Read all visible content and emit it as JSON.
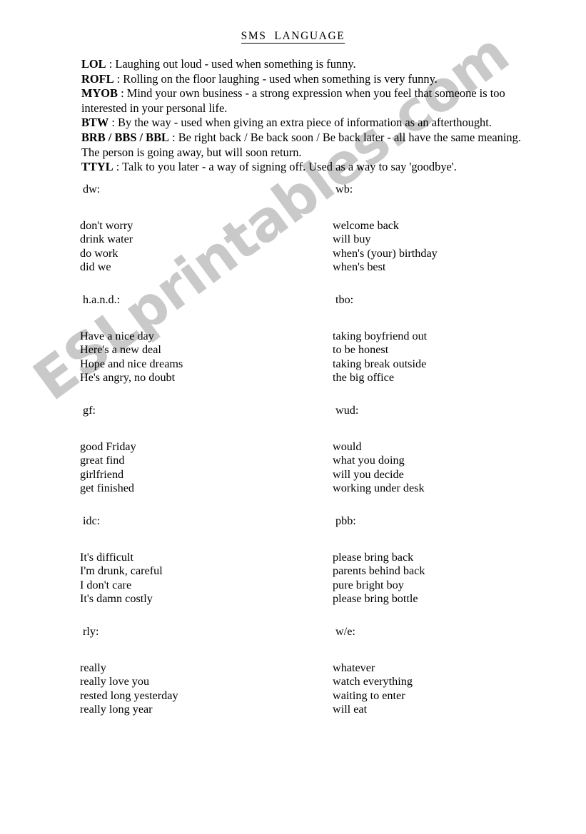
{
  "document": {
    "title": "SMS  LANGUAGE",
    "watermark": "ESLprintables.com",
    "watermark_color": "#c9c9c9"
  },
  "intro": {
    "entries": [
      {
        "abbr": "LOL",
        "sep": " : ",
        "definition": "Laughing out loud - used when something is funny."
      },
      {
        "abbr": "ROFL",
        "sep": " : ",
        "definition": "Rolling on the floor laughing - used when something is very funny."
      },
      {
        "abbr": "MYOB",
        "sep": " : ",
        "definition": "Mind your own business - a strong expression when you feel that someone is too interested in your personal life."
      },
      {
        "abbr": "BTW",
        "sep": " : ",
        "definition": "By the way - used when giving an extra piece of information as an afterthought."
      },
      {
        "abbr": "BRB / BBS / BBL",
        "sep": " : ",
        "definition": "Be right back / Be back soon / Be back later - all have the same meaning. The person is going away, but will soon return."
      },
      {
        "abbr": "TTYL",
        "sep": " : ",
        "definition": "Talk to you later - a way of signing off. Used as a way to say 'goodbye'."
      }
    ]
  },
  "groups": [
    {
      "left": {
        "header": "dw:",
        "items": [
          "don't worry",
          "drink water",
          "do work",
          "did we"
        ]
      },
      "right": {
        "header": "wb:",
        "items": [
          "welcome back",
          "will buy",
          "when's (your) birthday",
          "when's best"
        ]
      }
    },
    {
      "left": {
        "header": "h.a.n.d.:",
        "items": [
          "Have a nice day",
          "Here's a new deal",
          "Hope and nice dreams",
          "He's angry, no doubt"
        ]
      },
      "right": {
        "header": "tbo:",
        "items": [
          "taking boyfriend out",
          "to be honest",
          "taking break outside",
          "the big office"
        ]
      }
    },
    {
      "left": {
        "header": "gf:",
        "items": [
          "good Friday",
          "great find",
          "girlfriend",
          "get finished"
        ]
      },
      "right": {
        "header": "wud:",
        "items": [
          "would",
          "what you doing",
          "will you decide",
          "working under desk"
        ]
      }
    },
    {
      "left": {
        "header": "idc:",
        "items": [
          "It's difficult",
          "I'm drunk, careful",
          "I don't care",
          "It's damn costly"
        ]
      },
      "right": {
        "header": "pbb:",
        "items": [
          "please bring back",
          "parents behind back",
          "pure bright boy",
          "please bring bottle"
        ]
      }
    },
    {
      "left": {
        "header": "rly:",
        "items": [
          "really",
          "really love you",
          "rested long yesterday",
          "really long year"
        ]
      },
      "right": {
        "header": "w/e:",
        "items": [
          "whatever",
          "watch everything",
          "waiting to enter",
          "will eat"
        ]
      }
    }
  ]
}
